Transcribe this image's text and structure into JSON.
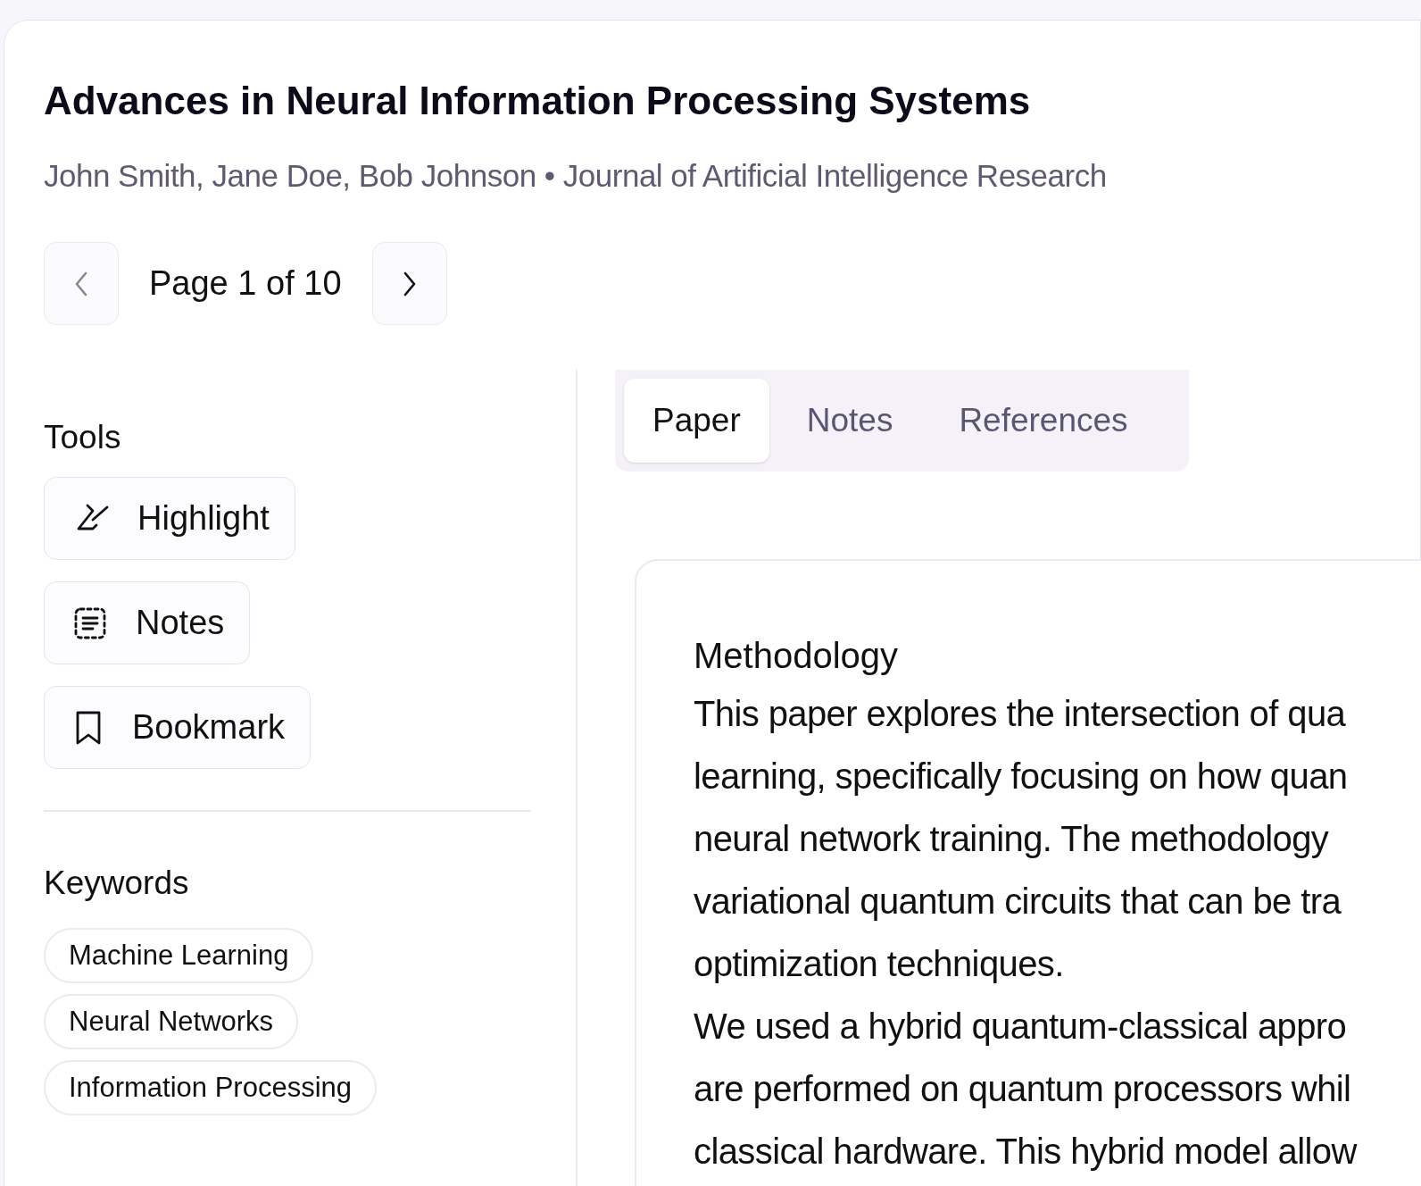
{
  "header": {
    "title": "Advances in Neural Information Processing Systems",
    "byline": "John Smith, Jane Doe, Bob Johnson • Journal of Artificial Intelligence Research"
  },
  "pagination": {
    "prev_disabled": true,
    "label": "Page 1 of 10",
    "next_disabled": false
  },
  "tools": {
    "heading": "Tools",
    "items": [
      {
        "kind": "highlight",
        "label": "Highlight"
      },
      {
        "kind": "notes",
        "label": "Notes"
      },
      {
        "kind": "bookmark",
        "label": "Bookmark"
      }
    ]
  },
  "keywords": {
    "heading": "Keywords",
    "items": [
      "Machine Learning",
      "Neural Networks",
      "Information Processing"
    ]
  },
  "tabs": [
    {
      "label": "Paper",
      "selected": true
    },
    {
      "label": "Notes",
      "selected": false
    },
    {
      "label": "References",
      "selected": false
    }
  ],
  "paper": {
    "heading": "Methodology",
    "paragraphs": [
      {
        "lines": [
          "This paper explores the intersection of qua",
          "learning, specifically focusing on how quan",
          "neural network training. The methodology",
          "variational quantum circuits that can be tra",
          "optimization techniques."
        ]
      },
      {
        "lines": [
          "We used a hybrid quantum-classical appro",
          "are performed on quantum processors whil",
          "classical hardware. This hybrid model allow"
        ]
      }
    ]
  }
}
